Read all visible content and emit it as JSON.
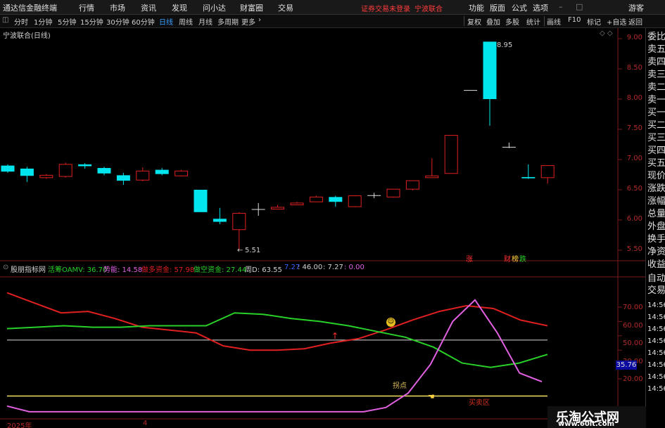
{
  "app": {
    "title": "通达信金融终端",
    "menus": [
      "行情",
      "市场",
      "资讯",
      "发现",
      "问小达",
      "财富圈",
      "交易"
    ],
    "status": "证券交易未登录",
    "stock_name": "宁波联合",
    "right_menus": [
      "功能",
      "版面",
      "公式",
      "选项"
    ],
    "guest": "游客"
  },
  "toolbar": {
    "periods": [
      "分时",
      "1分钟",
      "5分钟",
      "15分钟",
      "30分钟",
      "60分钟",
      "日线",
      "周线",
      "月线",
      "多周期",
      "更多"
    ],
    "active_period": "日线",
    "buttons": [
      "复权",
      "叠加",
      "多股",
      "统计",
      "画线",
      "F10",
      "标记",
      "+自选",
      "返回"
    ]
  },
  "chart": {
    "series_title": "宁波联合(日线)",
    "high_label": "8.95",
    "low_label": "5.51",
    "y_ticks": [
      "9.00",
      "8.50",
      "8.00",
      "7.50",
      "7.00",
      "6.50",
      "6.00",
      "5.50"
    ],
    "markers": [
      "涨",
      "财",
      "榜",
      "跌"
    ]
  },
  "candles": [
    {
      "o": 6.9,
      "c": 6.8,
      "h": 6.92,
      "l": 6.78
    },
    {
      "o": 6.85,
      "c": 6.73,
      "h": 6.88,
      "l": 6.63
    },
    {
      "o": 6.7,
      "c": 6.74,
      "h": 6.76,
      "l": 6.68
    },
    {
      "o": 6.72,
      "c": 6.92,
      "h": 6.95,
      "l": 6.7
    },
    {
      "o": 6.92,
      "c": 6.89,
      "h": 6.94,
      "l": 6.85
    },
    {
      "o": 6.86,
      "c": 6.77,
      "h": 6.88,
      "l": 6.74
    },
    {
      "o": 6.74,
      "c": 6.65,
      "h": 6.78,
      "l": 6.58
    },
    {
      "o": 6.66,
      "c": 6.81,
      "h": 6.87,
      "l": 6.64
    },
    {
      "o": 6.83,
      "c": 6.76,
      "h": 6.86,
      "l": 6.74
    },
    {
      "o": 6.73,
      "c": 6.81,
      "h": 6.83,
      "l": 6.72
    },
    {
      "o": 6.5,
      "c": 6.13,
      "h": 6.5,
      "l": 6.13
    },
    {
      "o": 6.02,
      "c": 5.97,
      "h": 6.2,
      "l": 5.93
    },
    {
      "o": 5.84,
      "c": 6.11,
      "h": 6.13,
      "l": 5.51
    },
    {
      "o": 6.18,
      "c": 6.18,
      "h": 6.28,
      "l": 6.07
    },
    {
      "o": 6.18,
      "c": 6.21,
      "h": 6.25,
      "l": 6.18
    },
    {
      "o": 6.25,
      "c": 6.28,
      "h": 6.3,
      "l": 6.25
    },
    {
      "o": 6.3,
      "c": 6.38,
      "h": 6.4,
      "l": 6.3
    },
    {
      "o": 6.38,
      "c": 6.3,
      "h": 6.4,
      "l": 6.22
    },
    {
      "o": 6.22,
      "c": 6.4,
      "h": 6.41,
      "l": 6.21
    },
    {
      "o": 6.41,
      "c": 6.41,
      "h": 6.45,
      "l": 6.36
    },
    {
      "o": 6.38,
      "c": 6.51,
      "h": 6.51,
      "l": 6.37
    },
    {
      "o": 6.51,
      "c": 6.65,
      "h": 6.65,
      "l": 6.49
    },
    {
      "o": 6.7,
      "c": 6.73,
      "h": 7.02,
      "l": 6.7
    },
    {
      "o": 6.77,
      "c": 7.4,
      "h": 7.4,
      "l": 6.77
    },
    {
      "o": 8.15,
      "c": 8.15,
      "h": 8.15,
      "l": 8.15
    },
    {
      "o": 8.95,
      "c": 8.0,
      "h": 8.95,
      "l": 7.56
    },
    {
      "o": 7.21,
      "c": 7.21,
      "h": 7.28,
      "l": 7.19
    },
    {
      "o": 6.71,
      "c": 6.69,
      "h": 6.92,
      "l": 6.68
    },
    {
      "o": 6.7,
      "c": 6.9,
      "h": 6.9,
      "l": 6.6
    }
  ],
  "indicator": {
    "name": "股朋指标网",
    "items": [
      {
        "label": "活筹OAMV: 36.70",
        "color": "#28d028"
      },
      {
        "label": "势能: 14.58",
        "color": "#e060e0"
      },
      {
        "label": "做多资金: 57.98",
        "color": "#e02020"
      },
      {
        "label": "做空资金: 27.44",
        "color": "#28d028"
      },
      {
        "label": "周D: 63.55",
        "color": "#cfcfcf"
      },
      {
        "label": "7.27",
        "color": "#3a60ff"
      },
      {
        "label": ": 46.00",
        "color": "#cfcfcf"
      },
      {
        "label": ": 7.27",
        "color": "#cfcfcf"
      },
      {
        "label": ": 0.00",
        "color": "#e060e0"
      }
    ],
    "y_ticks": [
      "70.00",
      "60.00",
      "50.00",
      "40.00",
      "30.00",
      "20.00"
    ],
    "current_tag": "35.76",
    "turning_label": "拐点",
    "bottom_label": "买卖区",
    "red_line": [
      80,
      73,
      66,
      67,
      62,
      56,
      54,
      52,
      43,
      40,
      40,
      41,
      45,
      48,
      54,
      61,
      67,
      71,
      69,
      61,
      57
    ],
    "green_line": [
      55,
      56,
      57,
      56,
      56,
      57,
      57,
      57,
      66,
      65,
      62,
      60,
      57,
      53,
      49,
      42,
      31,
      28,
      31,
      37
    ],
    "magenta_line": [
      1,
      -3,
      -3,
      -3,
      -3,
      -3,
      -3,
      -3,
      -3,
      -3,
      -3,
      -3,
      -3,
      -3,
      -3,
      -3,
      -3,
      0,
      10,
      30,
      60,
      75,
      52,
      24,
      18
    ],
    "mid_level": 47,
    "low_level": 8
  },
  "x_axis": {
    "left_label": "2025年",
    "month_label": "4"
  },
  "right_panel": {
    "items": [
      "委比",
      "卖五",
      "卖四",
      "卖三",
      "卖二",
      "卖一",
      "买一",
      "买二",
      "买三",
      "买四",
      "买五",
      "现价",
      "涨跌",
      "涨幅",
      "总量",
      "外盘",
      "换手",
      "净资",
      "收益"
    ],
    "items2": [
      "自动",
      "交易"
    ],
    "times": [
      "14:56",
      "14:56",
      "14:56",
      "14:56",
      "14:56",
      "14:56",
      "14:56",
      "14:56",
      "14:56"
    ]
  },
  "watermark": {
    "line1": "乐淘公式网",
    "line2": "www.60lt.com"
  }
}
